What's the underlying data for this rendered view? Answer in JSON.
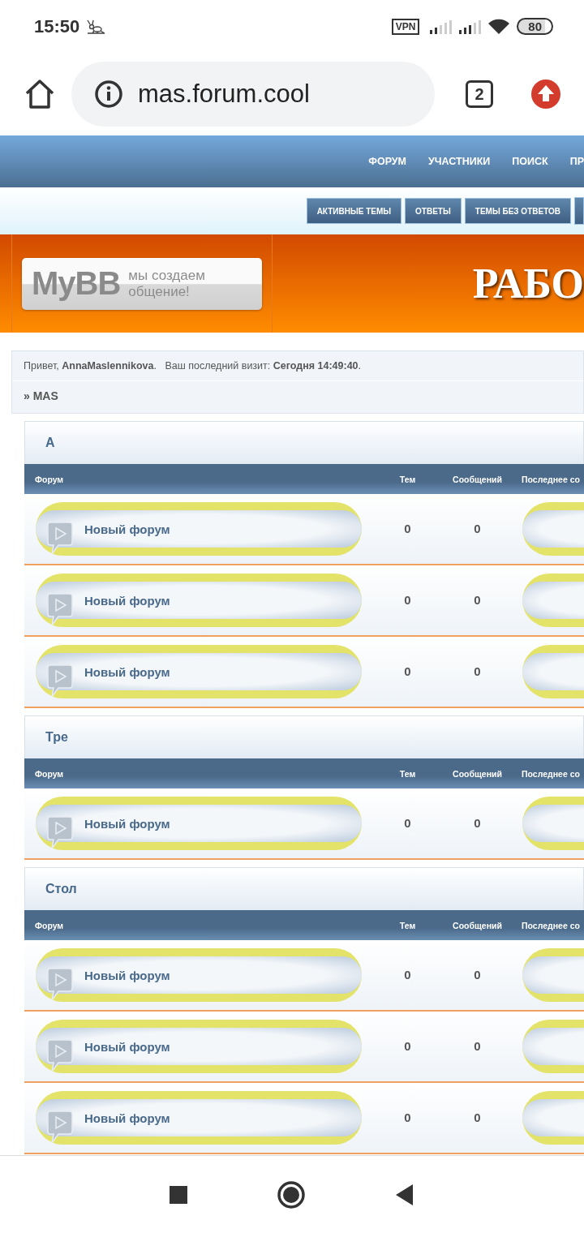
{
  "status_bar": {
    "time": "15:50",
    "vpn": "VPN",
    "battery": "80"
  },
  "browser": {
    "url": "mas.forum.cool",
    "tab_count": "2"
  },
  "nav": [
    "ФОРУМ",
    "УЧАСТНИКИ",
    "ПОИСК",
    "ПР"
  ],
  "subnav": [
    "АКТИВНЫЕ ТЕМЫ",
    "ОТВЕТЫ",
    "ТЕМЫ БЕЗ ОТВЕТОВ"
  ],
  "header": {
    "logo": "MyBB",
    "tagline": "мы создаем общение!",
    "title": "РАБО"
  },
  "welcome": {
    "text": "Привет, **AnnaMaslennikova**.   Ваш последний визит: **Сегодня 14:49:40**.",
    "breadcrumb": "» MAS"
  },
  "categories": [
    {
      "title": "А",
      "columns": [
        "Форум",
        "Тем",
        "Сообщений",
        "Последнее со"
      ],
      "forums": [
        {
          "name": "Новый форум",
          "topics": "0",
          "posts": "0"
        },
        {
          "name": "Новый форум",
          "topics": "0",
          "posts": "0"
        },
        {
          "name": "Новый форум",
          "topics": "0",
          "posts": "0"
        }
      ]
    },
    {
      "title": "Тре",
      "columns": [
        "Форум",
        "Тем",
        "Сообщений",
        "Последнее со"
      ],
      "forums": [
        {
          "name": "Новый форум",
          "topics": "0",
          "posts": "0"
        }
      ]
    },
    {
      "title": "Стол",
      "columns": [
        "Форум",
        "Тем",
        "Сообщений",
        "Последнее со"
      ],
      "forums": [
        {
          "name": "Новый форум",
          "topics": "0",
          "posts": "0"
        },
        {
          "name": "Новый форум",
          "topics": "0",
          "posts": "0"
        },
        {
          "name": "Новый форум",
          "topics": "0",
          "posts": "0"
        }
      ]
    }
  ]
}
